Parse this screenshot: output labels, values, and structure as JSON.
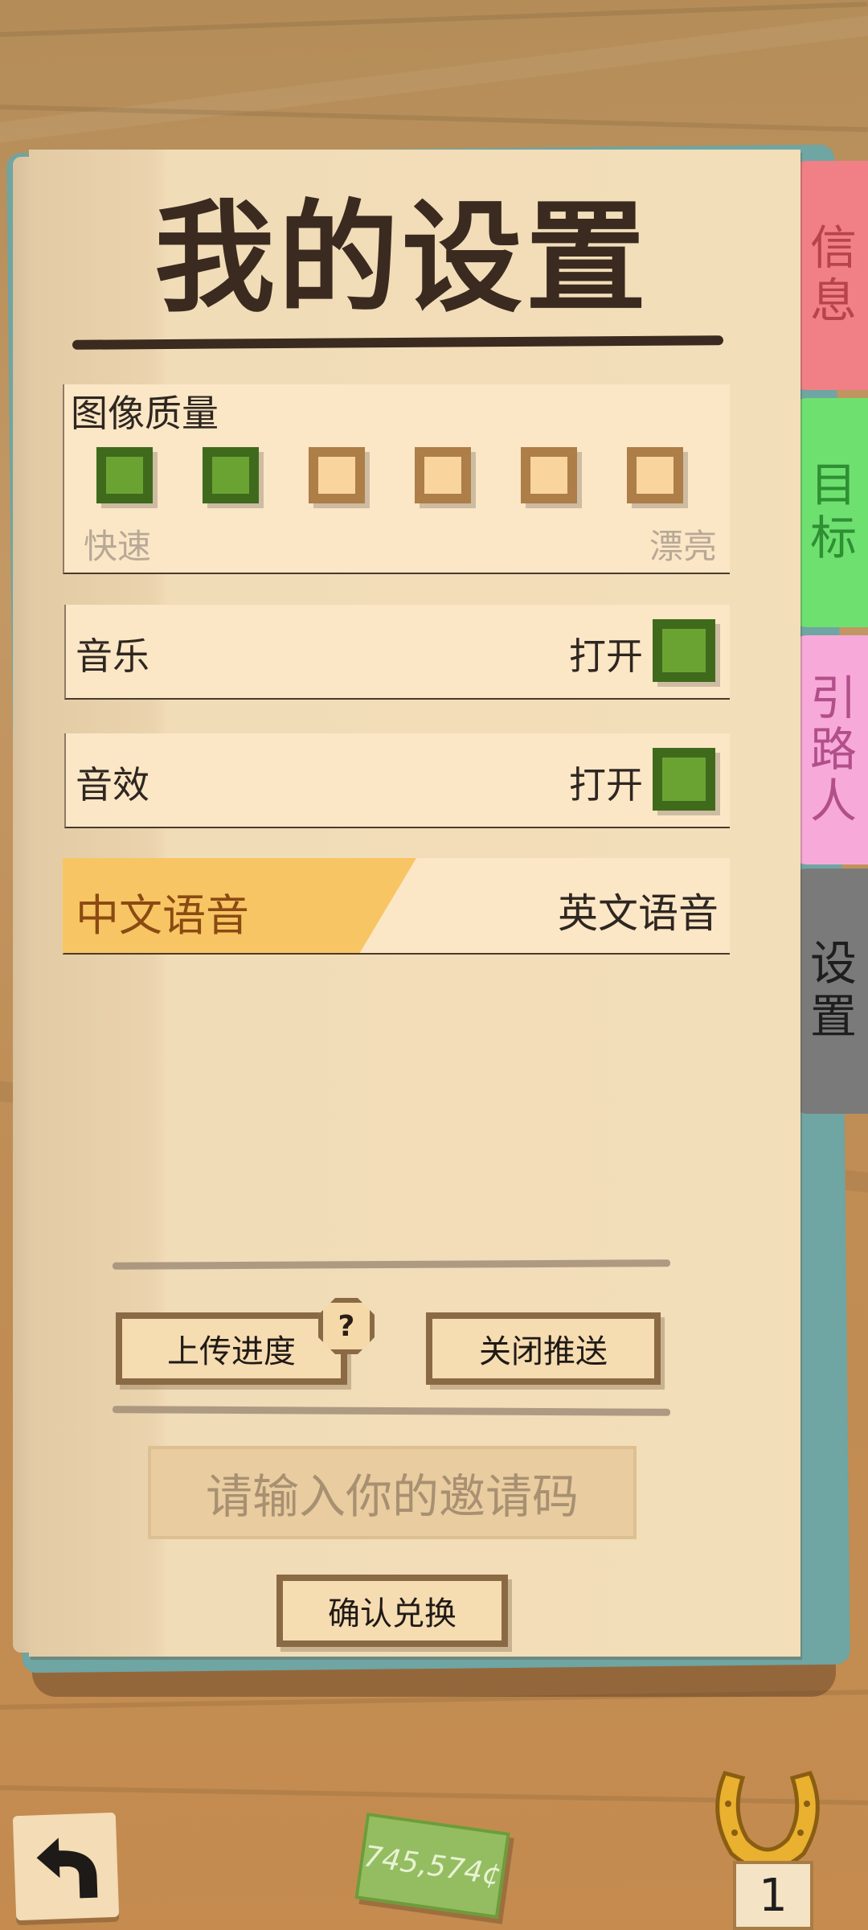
{
  "title": "我的设置",
  "image_quality": {
    "label": "图像质量",
    "levels_total": 6,
    "level_selected": 2,
    "low_label": "快速",
    "high_label": "漂亮"
  },
  "music": {
    "label": "音乐",
    "state": "打开",
    "on": true
  },
  "sfx": {
    "label": "音效",
    "state": "打开",
    "on": true
  },
  "voice": {
    "selected": "中文语音",
    "other": "英文语音"
  },
  "tabs": [
    {
      "label": "信息",
      "color": "#f17f86"
    },
    {
      "label": "目标",
      "color": "#6ee070"
    },
    {
      "label": "引路人",
      "color": "#f7aad9"
    },
    {
      "label": "设置",
      "color": "#7a7a7a",
      "active": true
    }
  ],
  "buttons": {
    "upload": "上传进度",
    "help": "?",
    "close_push": "关闭推送",
    "confirm": "确认兑换"
  },
  "invite": {
    "placeholder": "请输入你的邀请码"
  },
  "footer": {
    "money": "745,574¢",
    "horseshoe_count": "1"
  },
  "icons": [
    "back-arrow-icon",
    "horseshoe-icon",
    "cash-icon"
  ],
  "colors": {
    "accent_green": "#6aa332",
    "voice_highlight": "#f7c563",
    "page": "#f2deb9"
  }
}
